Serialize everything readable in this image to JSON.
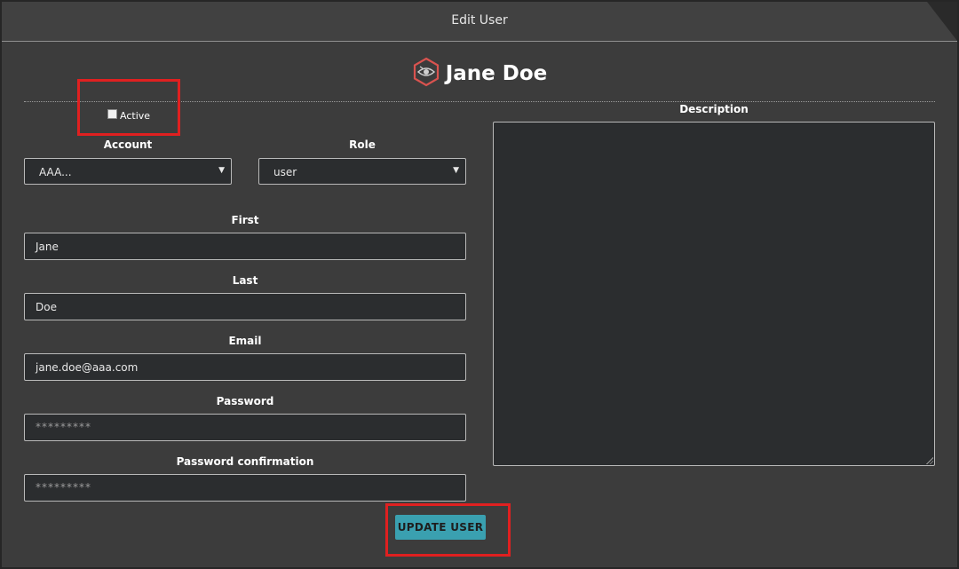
{
  "window": {
    "title": "Edit User"
  },
  "header": {
    "icon": "eye-hexagon-icon",
    "user_name": "Jane Doe"
  },
  "form": {
    "active": {
      "label": "Active",
      "checked": false
    },
    "account": {
      "label": "Account",
      "value": "AAA..."
    },
    "role": {
      "label": "Role",
      "value": "user"
    },
    "first": {
      "label": "First",
      "value": "Jane"
    },
    "last": {
      "label": "Last",
      "value": "Doe"
    },
    "email": {
      "label": "Email",
      "value": "jane.doe@aaa.com"
    },
    "password": {
      "label": "Password",
      "placeholder": "*********"
    },
    "password_confirmation": {
      "label": "Password confirmation",
      "placeholder": "*********"
    },
    "description": {
      "label": "Description",
      "value": ""
    },
    "submit_label": "UPDATE USER"
  },
  "colors": {
    "accent": "#3aa0b0",
    "highlight": "#e02020",
    "logo": "#d9534f"
  }
}
